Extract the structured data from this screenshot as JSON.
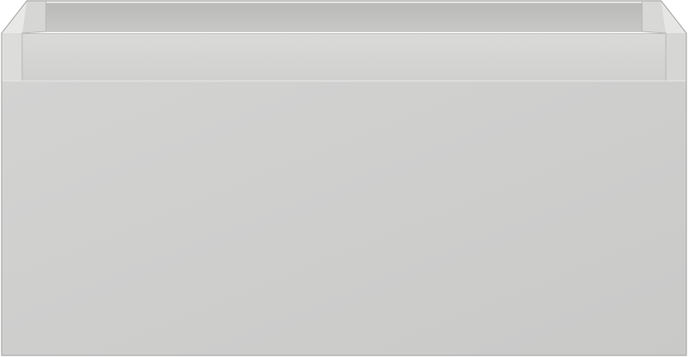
{
  "image": {
    "subject": "cabinet-drawer-unit",
    "colors": {
      "background": "#ffffff",
      "front_panel": "#cdcdcc",
      "front_panel_light": "#d2d2d1",
      "rim_top": "#e6e6e5",
      "rim_face": "#d4d4d3",
      "inner_back_wall": "#c3c3c2",
      "inner_shadow": "#b4b4b3",
      "side_post": "#d9d9d8",
      "outline": "#a9a9a8"
    }
  }
}
